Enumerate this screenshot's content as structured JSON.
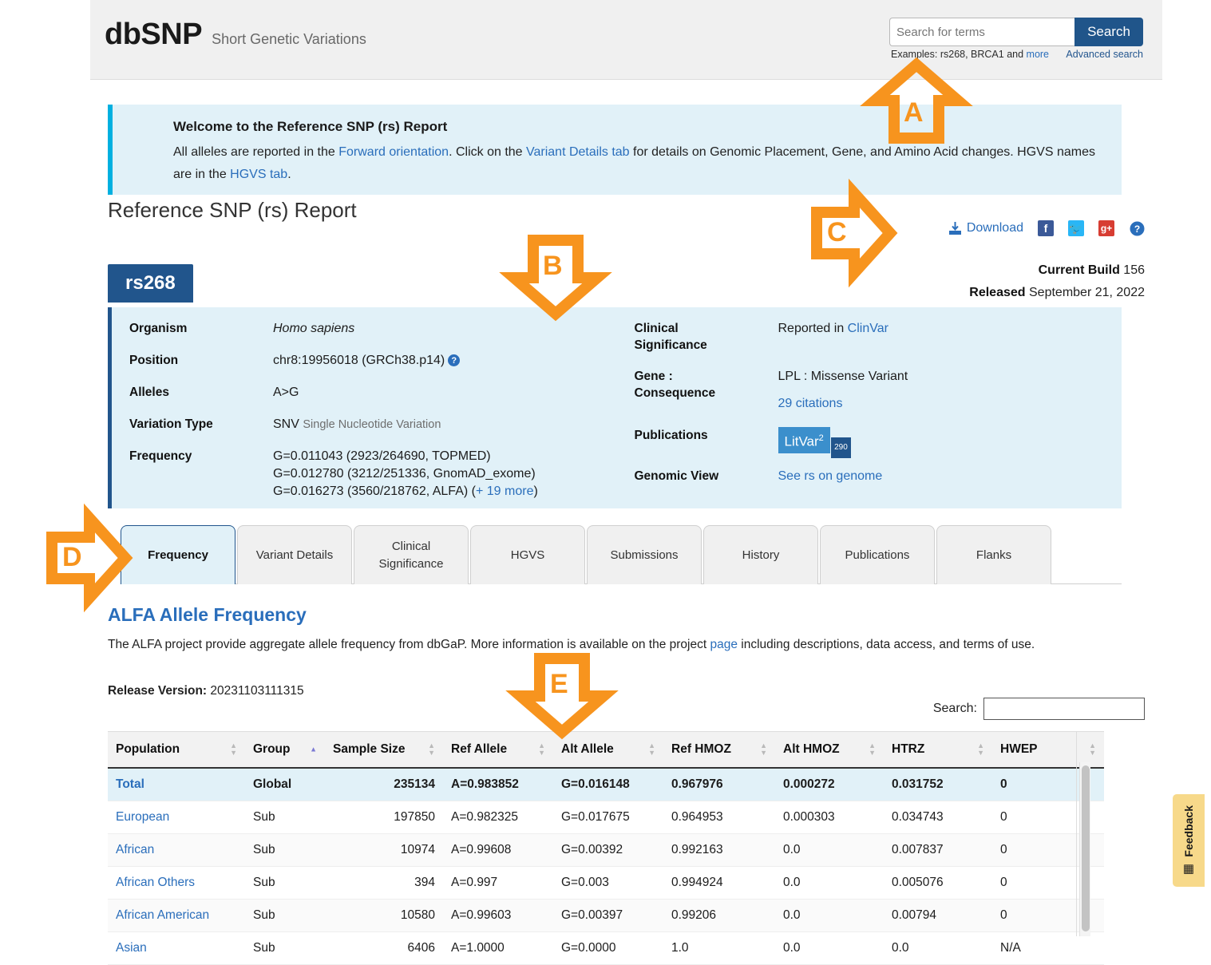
{
  "header": {
    "logo": "dbSNP",
    "tagline": "Short Genetic Variations",
    "search": {
      "placeholder": "Search for terms",
      "value": "",
      "button": "Search",
      "examples_prefix": "Examples: rs268, BRCA1 and ",
      "examples_more": "more",
      "advanced": "Advanced search"
    }
  },
  "welcome": {
    "title": "Welcome to the Reference SNP (rs) Report",
    "line1_a": "All alleles are reported in the ",
    "line1_link1": "Forward orientation",
    "line1_b": ". Click on the ",
    "line1_link2": "Variant Details tab",
    "line1_c": " for details on Genomic Placement, Gene, and Amino Acid changes. HGVS names are in the ",
    "line1_link3": "HGVS tab",
    "line1_d": "."
  },
  "page": {
    "title": "Reference SNP (rs) Report",
    "download_label": "Download",
    "build_label": "Current Build",
    "build_value": "156",
    "released_label": "Released",
    "released_value": "September 21, 2022"
  },
  "rs": {
    "id": "rs268",
    "left": [
      {
        "label": "Organism",
        "value": "Homo sapiens",
        "style": "italic"
      },
      {
        "label": "Position",
        "value": "chr8:19956018 (GRCh38.p14)",
        "help": true
      },
      {
        "label": "Alleles",
        "value": "A>G"
      },
      {
        "label": "Variation Type",
        "value": "SNV",
        "suffix": "Single Nucleotide Variation"
      },
      {
        "label": "Frequency",
        "lines": [
          "G=0.011043 (2923/264690, TOPMED)",
          "G=0.012780 (3212/251336, GnomAD_exome)",
          "G=0.016273 (3560/218762, ALFA)"
        ],
        "more_link": "+ 19 more"
      }
    ],
    "right": [
      {
        "label": "Clinical Significance",
        "prefix": "Reported in ",
        "link": "ClinVar"
      },
      {
        "label": "Gene : Consequence",
        "value": "LPL : Missense Variant",
        "link2": "29 citations"
      },
      {
        "label": "Publications",
        "badge": "LitVar",
        "badge_sup": "2",
        "badge_count": "290"
      },
      {
        "label": "Genomic View",
        "link": "See rs on genome"
      }
    ]
  },
  "tabs": [
    {
      "label": "Frequency",
      "active": true
    },
    {
      "label": "Variant Details",
      "active": false
    },
    {
      "label": "Clinical Significance",
      "active": false
    },
    {
      "label": "HGVS",
      "active": false
    },
    {
      "label": "Submissions",
      "active": false
    },
    {
      "label": "History",
      "active": false
    },
    {
      "label": "Publications",
      "active": false
    },
    {
      "label": "Flanks",
      "active": false
    }
  ],
  "alfa": {
    "title": "ALFA Allele Frequency",
    "desc_a": "The ALFA project provide aggregate allele frequency from dbGaP. More information is available on the project ",
    "desc_link": "page",
    "desc_b": " including descriptions, data access, and terms of use.",
    "release_label": "Release Version:",
    "release_value": "20231103111315",
    "table_search_label": "Search:",
    "table_search_value": ""
  },
  "table": {
    "columns": [
      {
        "label": "Population",
        "sorted": false
      },
      {
        "label": "Group",
        "sorted": true,
        "dir": "asc"
      },
      {
        "label": "Sample Size",
        "sorted": false
      },
      {
        "label": "Ref Allele",
        "sorted": false
      },
      {
        "label": "Alt Allele",
        "sorted": false
      },
      {
        "label": "Ref HMOZ",
        "sorted": false
      },
      {
        "label": "Alt HMOZ",
        "sorted": false
      },
      {
        "label": "HTRZ",
        "sorted": false
      },
      {
        "label": "HWEP",
        "sorted": false
      }
    ],
    "rows": [
      {
        "population": "Total",
        "group": "Global",
        "sample_size": "235134",
        "ref_allele": "A=0.983852",
        "alt_allele": "G=0.016148",
        "ref_hmoz": "0.967976",
        "alt_hmoz": "0.000272",
        "htrz": "0.031752",
        "hwep": "0",
        "highlight": true
      },
      {
        "population": "European",
        "group": "Sub",
        "sample_size": "197850",
        "ref_allele": "A=0.982325",
        "alt_allele": "G=0.017675",
        "ref_hmoz": "0.964953",
        "alt_hmoz": "0.000303",
        "htrz": "0.034743",
        "hwep": "0",
        "highlight": false
      },
      {
        "population": "African",
        "group": "Sub",
        "sample_size": "10974",
        "ref_allele": "A=0.99608",
        "alt_allele": "G=0.00392",
        "ref_hmoz": "0.992163",
        "alt_hmoz": "0.0",
        "htrz": "0.007837",
        "hwep": "0",
        "highlight": false
      },
      {
        "population": "African Others",
        "group": "Sub",
        "sample_size": "394",
        "ref_allele": "A=0.997",
        "alt_allele": "G=0.003",
        "ref_hmoz": "0.994924",
        "alt_hmoz": "0.0",
        "htrz": "0.005076",
        "hwep": "0",
        "highlight": false
      },
      {
        "population": "African American",
        "group": "Sub",
        "sample_size": "10580",
        "ref_allele": "A=0.99603",
        "alt_allele": "G=0.00397",
        "ref_hmoz": "0.99206",
        "alt_hmoz": "0.0",
        "htrz": "0.00794",
        "hwep": "0",
        "highlight": false
      },
      {
        "population": "Asian",
        "group": "Sub",
        "sample_size": "6406",
        "ref_allele": "A=1.0000",
        "alt_allele": "G=0.0000",
        "ref_hmoz": "1.0",
        "alt_hmoz": "0.0",
        "htrz": "0.0",
        "hwep": "N/A",
        "highlight": false
      }
    ]
  },
  "feedback": {
    "label": "Feedback"
  },
  "annotations": [
    {
      "id": "A",
      "letter": "A",
      "direction": "up"
    },
    {
      "id": "B",
      "letter": "B",
      "direction": "down"
    },
    {
      "id": "C",
      "letter": "C",
      "direction": "right"
    },
    {
      "id": "D",
      "letter": "D",
      "direction": "right"
    },
    {
      "id": "E",
      "letter": "E",
      "direction": "down"
    }
  ],
  "colors": {
    "accent_blue": "#2a6ebb",
    "dark_blue": "#21558c",
    "panel_blue": "#e1f1f8",
    "cyan_bar": "#00b0e0",
    "annotation_orange": "#f7941e",
    "feedback_yellow": "#f7d98a"
  }
}
